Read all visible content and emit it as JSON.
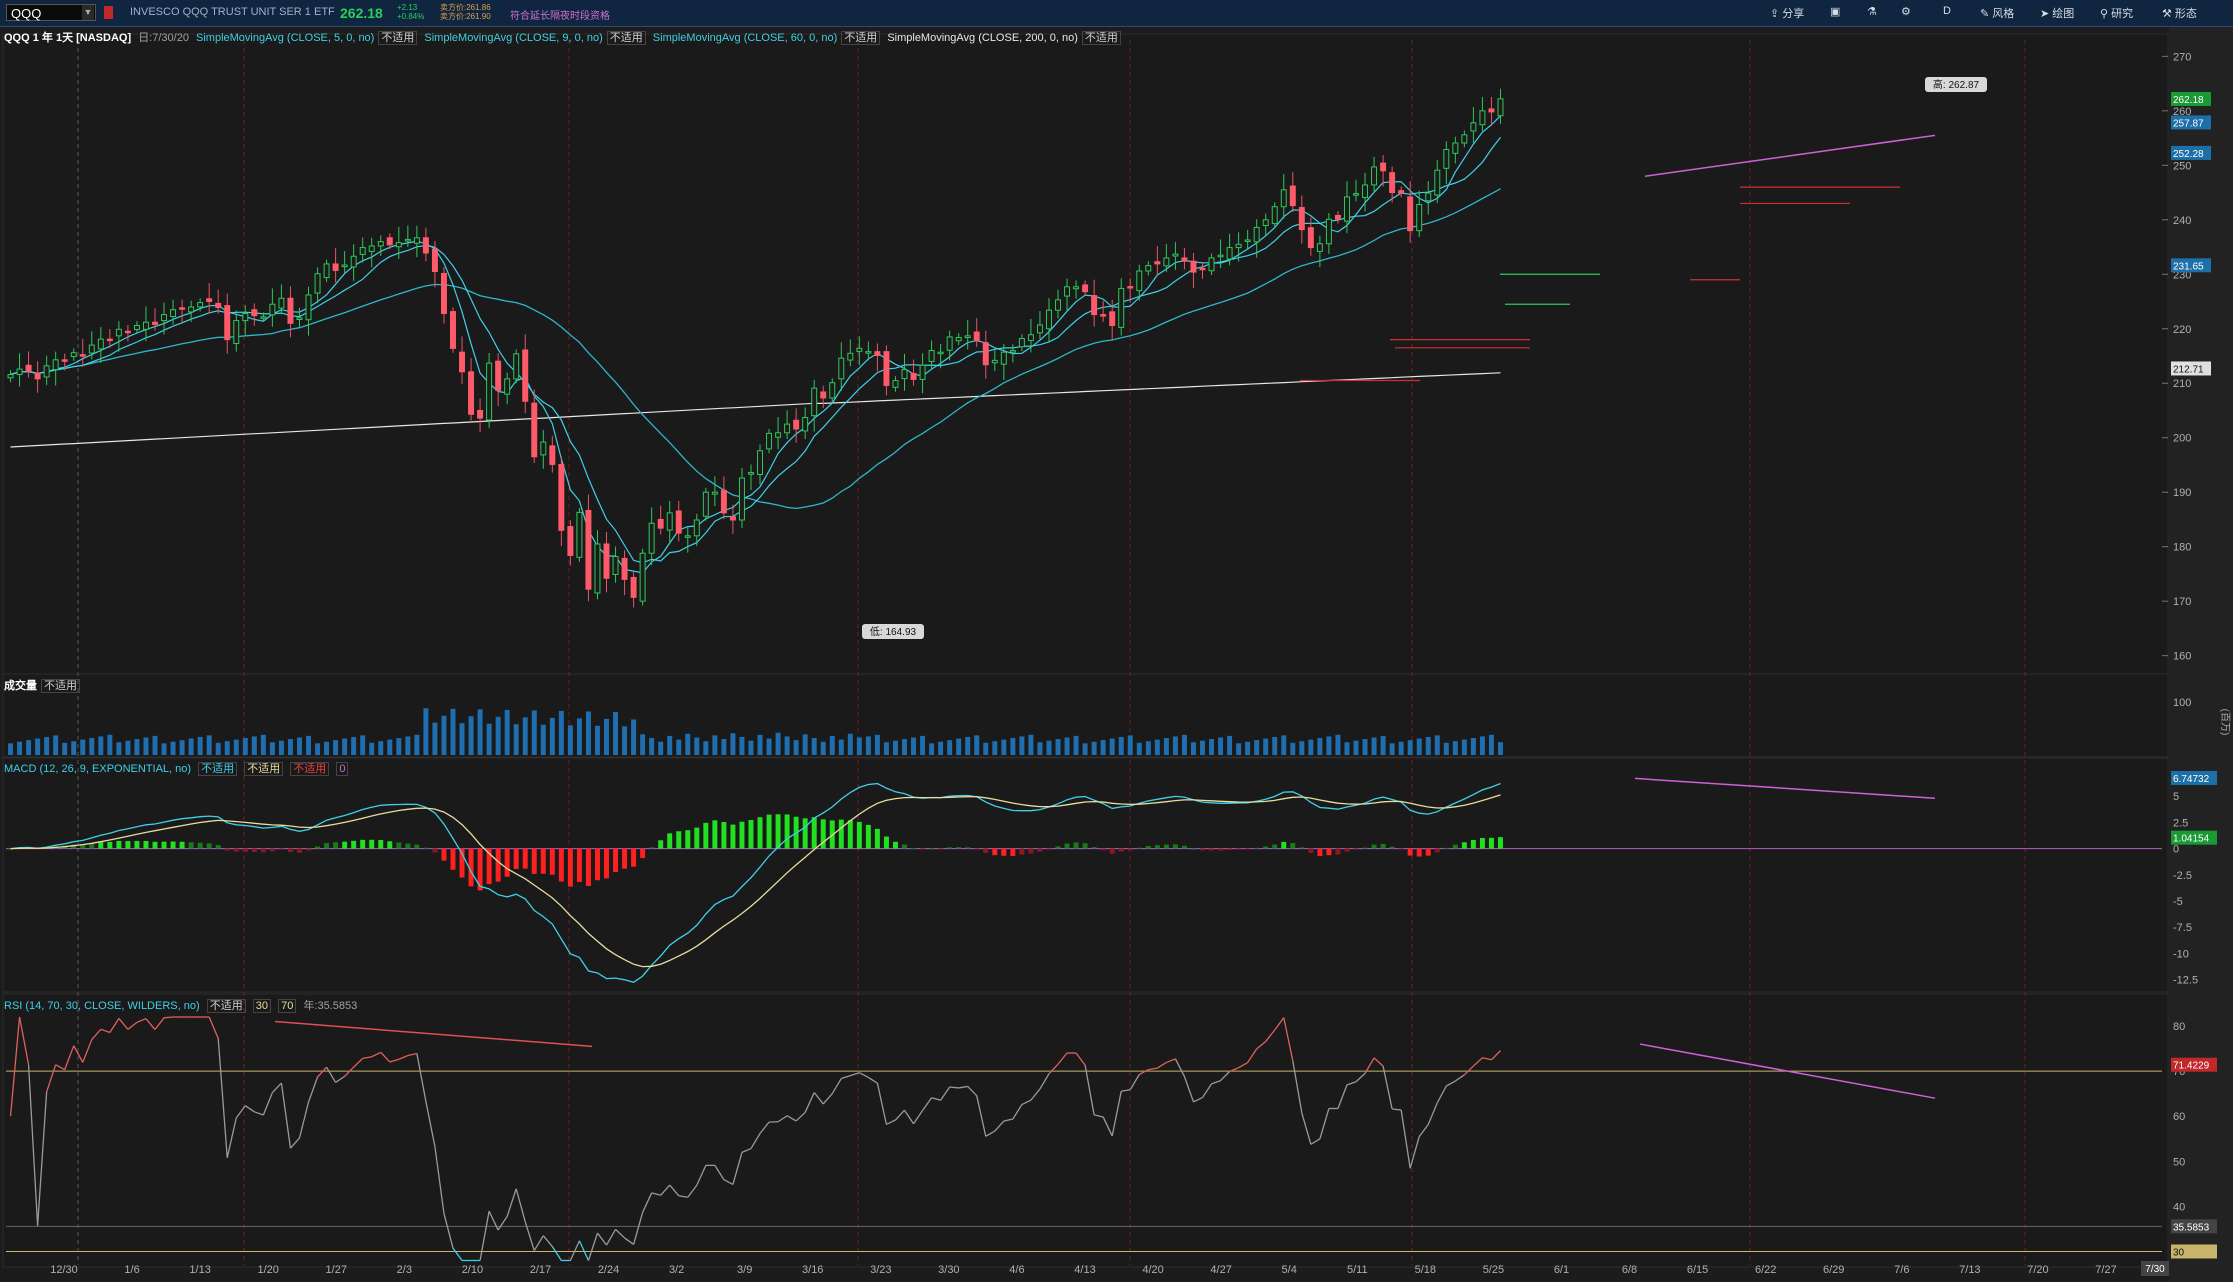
{
  "toolbar": {
    "symbol": "QQQ",
    "instrument_name": "INVESCO QQQ TRUST UNIT SER 1 ETF",
    "last_price": "262.18",
    "change_abs": "+2.13",
    "change_pct": "+0.84%",
    "bid": "卖方价:261.86",
    "ask": "卖方价:261.90",
    "extended_label": "符合延长隔夜时段资格",
    "buttons": [
      "分享",
      "D",
      "风格",
      "绘图",
      "研究",
      "形态"
    ]
  },
  "price_panel": {
    "header_symbol": "QQQ 1 年 1天 [NASDAQ]",
    "date_label": "日:7/30/20",
    "studies": [
      {
        "label": "SimpleMovingAvg (CLOSE, 5, 0, no)",
        "value": "不适用",
        "color": "#3fd0e8"
      },
      {
        "label": "SimpleMovingAvg (CLOSE, 9, 0, no)",
        "value": "不适用",
        "color": "#3fd0e8"
      },
      {
        "label": "SimpleMovingAvg (CLOSE, 60, 0, no)",
        "value": "不适用",
        "color": "#3fd0e8"
      },
      {
        "label": "SimpleMovingAvg (CLOSE, 200, 0, no)",
        "value": "不适用",
        "color": "#e8e8e8"
      }
    ],
    "high_label": "高: 262.87",
    "low_label": "低: 164.93",
    "y_ticks": [
      160,
      170,
      180,
      190,
      200,
      210,
      220,
      230,
      240,
      250,
      260,
      270
    ],
    "ylim": [
      157,
      273
    ],
    "price_tags": [
      {
        "value": "262.18",
        "price": 262.18,
        "color": "#1a9a35"
      },
      {
        "value": "257.87",
        "price": 257.87,
        "color": "#1d6fa8"
      },
      {
        "value": "252.28",
        "price": 252.28,
        "color": "#1d6fa8"
      },
      {
        "value": "231.65",
        "price": 231.65,
        "color": "#1d6fa8"
      },
      {
        "value": "212.71",
        "price": 212.71,
        "color": "#e0e0e0"
      }
    ]
  },
  "volume_panel": {
    "label": "成交量",
    "value": "不适用",
    "y_ticks": [
      100
    ],
    "unit": "(百万)"
  },
  "macd_panel": {
    "label": "MACD (12, 26, 9, EXPONENTIAL, no)",
    "values": [
      "不适用",
      "不适用",
      "不适用",
      "0"
    ],
    "y_ticks": [
      5,
      2.5,
      0,
      -2.5,
      -5,
      -7.5,
      -10,
      -12.5
    ],
    "ylim": [
      -13.5,
      7.5
    ],
    "tags": [
      {
        "value": "6.74732",
        "y": 6.74,
        "color": "#1d6fa8"
      },
      {
        "value": "1.04154",
        "y": 1.04,
        "color": "#1a9a35"
      }
    ]
  },
  "rsi_panel": {
    "label": "RSI (14, 70, 30, CLOSE, WILDERS, no)",
    "values": [
      "不适用",
      "30",
      "70"
    ],
    "extra": "年:35.5853",
    "y_ticks": [
      30,
      40,
      50,
      60,
      70,
      80
    ],
    "ylim": [
      27,
      84
    ],
    "tags": [
      {
        "value": "71.4229",
        "y": 71.42,
        "color": "#c0282a"
      },
      {
        "value": "35.5853",
        "y": 35.58,
        "color": "#444"
      },
      {
        "value": "30",
        "y": 30,
        "color": "#c8b46a"
      }
    ]
  },
  "x_axis": {
    "labels": [
      "12/30",
      "1/6",
      "1/13",
      "1/20",
      "1/27",
      "2/3",
      "2/10",
      "2/17",
      "2/24",
      "3/2",
      "3/9",
      "3/16",
      "3/23",
      "3/30",
      "4/6",
      "4/13",
      "4/20",
      "4/27",
      "5/4",
      "5/11",
      "5/18",
      "5/25",
      "6/1",
      "6/8",
      "6/15",
      "6/22",
      "6/29",
      "7/6",
      "7/13",
      "7/20",
      "7/27"
    ],
    "current": "7/30"
  },
  "chart_data": {
    "type": "candlestick",
    "title": "QQQ 1 年 1天 [NASDAQ]",
    "x_start": "12/30",
    "closes": [
      211.6,
      212.6,
      212.2,
      210.8,
      213.2,
      214.3,
      214.2,
      215.6,
      215.2,
      217.0,
      218.1,
      218.0,
      219.9,
      219.5,
      220.6,
      221.2,
      220.8,
      222.6,
      223.5,
      223.8,
      224.0,
      224.8,
      225.0,
      223.9,
      218.0,
      221.5,
      222.8,
      222.4,
      222.2,
      224.5,
      225.6,
      221.0,
      222.0,
      226.2,
      230.1,
      231.9,
      230.7,
      231.7,
      233.3,
      234.9,
      235.2,
      236.0,
      235.4,
      235.8,
      236.4,
      236.7,
      233.9,
      230.5,
      222.8,
      216.4,
      212.1,
      204.3,
      203.6,
      213.7,
      208.7,
      210.8,
      215.4,
      206.7,
      196.5,
      199.2,
      195.1,
      183.0,
      178.4,
      186.3,
      172.2,
      180.5,
      174.2,
      178.2,
      174.0,
      170.7,
      178.8,
      184.3,
      183.4,
      186.2,
      182.5,
      182.0,
      184.9,
      190.0,
      190.0,
      186.2,
      184.9,
      192.6,
      193.6,
      197.6,
      200.8,
      200.9,
      202.5,
      201.6,
      203.7,
      209.1,
      207.3,
      210.1,
      214.6,
      215.5,
      216.4,
      215.8,
      215.1,
      209.6,
      210.5,
      212.5,
      210.7,
      213.3,
      216.0,
      215.7,
      218.5,
      218.4,
      218.7,
      217.8,
      213.4,
      214.2,
      215.7,
      216.0,
      218.2,
      218.9,
      220.7,
      223.4,
      225.3,
      227.7,
      227.7,
      226.8,
      222.6,
      222.4,
      220.6,
      227.4,
      227.7,
      230.6,
      231.6,
      231.9,
      233.0,
      233.7,
      232.4,
      230.4,
      231.0,
      233.0,
      233.5,
      234.9,
      235.5,
      236.3,
      238.6,
      240.0,
      242.4,
      245.5,
      242.6,
      238.2,
      234.9,
      235.6,
      240.1,
      240.1,
      244.2,
      244.8,
      246.4,
      249.7,
      249.0,
      245.0,
      244.9,
      238.0,
      242.8,
      244.9,
      249.1,
      252.9,
      254.1,
      255.6,
      257.8,
      260.0,
      259.8,
      262.2
    ],
    "y_range": [
      157,
      273
    ],
    "volume_y_ticks": [
      100
    ],
    "macd_y_ticks": [
      5,
      2.5,
      0,
      -2.5,
      -5,
      -7.5,
      -10,
      -12.5
    ],
    "rsi_y_ticks": [
      30,
      40,
      50,
      60,
      70,
      80
    ],
    "legend_placement": "top-left",
    "grid": true
  }
}
